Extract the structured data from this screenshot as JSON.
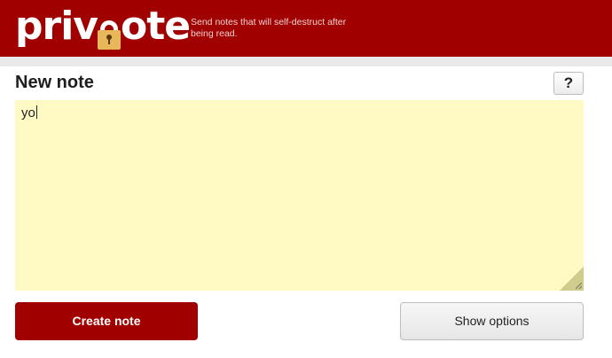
{
  "header": {
    "logo": {
      "text_before": "priv",
      "text_after": "ote",
      "lock_icon": "padlock-icon"
    },
    "tagline": "Send notes that will self-destruct after being read."
  },
  "editor": {
    "title": "New note",
    "help_label": "?",
    "note_value": "yo"
  },
  "actions": {
    "create_label": "Create note",
    "options_label": "Show options"
  },
  "colors": {
    "brand": "#a00000",
    "note_background": "#fffac4",
    "page_background": "#ffffff"
  }
}
